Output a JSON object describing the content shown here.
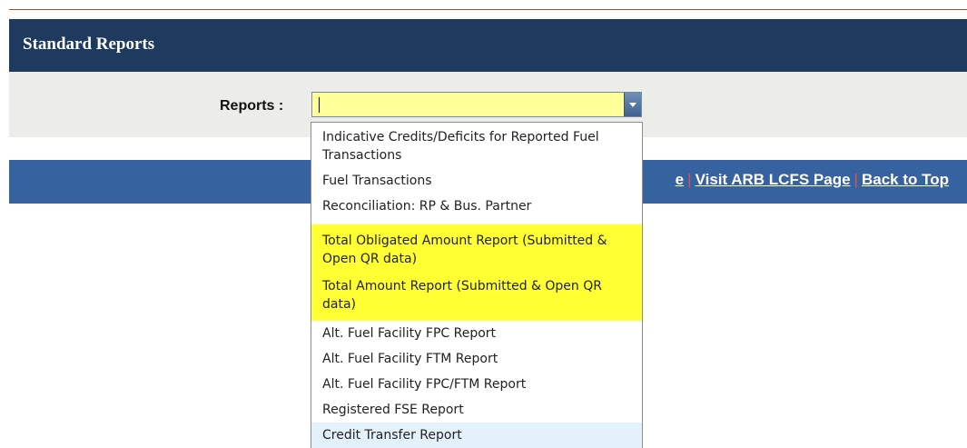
{
  "header": {
    "title": "Standard Reports"
  },
  "filter": {
    "label": "Reports :",
    "select_value": ""
  },
  "footer": {
    "partial_link": "e",
    "link_arb": "Visit ARB LCFS Page",
    "link_top": "Back to Top",
    "separator": "|"
  },
  "dropdown": {
    "options": [
      "Indicative Credits/Deficits for Reported Fuel Transactions",
      "Fuel Transactions",
      "Reconciliation: RP & Bus. Partner",
      "Total Obligated Amount Report (Submitted & Open QR data)",
      "Total Amount Report (Submitted & Open QR data)",
      "Alt. Fuel Facility FPC Report",
      "Alt. Fuel Facility FTM Report",
      "Alt. Fuel Facility FPC/FTM Report",
      "Registered FSE Report",
      "Credit Transfer Report"
    ]
  },
  "colors": {
    "header_bg": "#1f3a5f",
    "footer_bg": "#3762a0",
    "select_bg": "#ffff99",
    "highlight": "#ffff33"
  }
}
